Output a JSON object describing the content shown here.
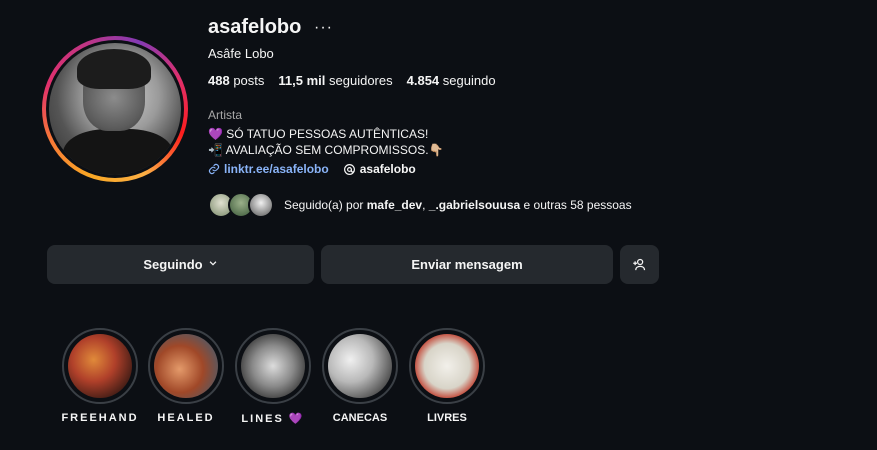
{
  "profile": {
    "username": "asafelobo",
    "more_icon": "more-horizontal-icon",
    "full_name": "Asâfe Lobo",
    "stats": {
      "posts_count": "488",
      "posts_label": "posts",
      "followers_count": "11,5 mil",
      "followers_label": "seguidores",
      "following_count": "4.854",
      "following_label": "seguindo"
    },
    "category": "Artista",
    "bio_line1": "💜 SÓ TATUO PESSOAS AUTÊNTICAS!",
    "bio_line2": "📲 AVALIAÇÃO SEM COMPROMISSOS.👇🏼",
    "link": "linktr.ee/asafelobo",
    "threads_handle": "asafelobo",
    "followed_by": {
      "prefix": "Seguido(a) por",
      "user1": "mafe_dev",
      "separator": ",",
      "user2": "_.gabrielsouusa",
      "suffix": "e outras 58 pessoas"
    }
  },
  "actions": {
    "following_label": "Seguindo",
    "message_label": "Enviar mensagem",
    "add_user_icon": "add-user-icon"
  },
  "highlights": [
    {
      "label": "FREEHAND"
    },
    {
      "label": "HEALED"
    },
    {
      "label": "LINES 💜"
    },
    {
      "label": "CANECAS"
    },
    {
      "label": "LIVRES"
    }
  ],
  "colors": {
    "background": "#0c0f14",
    "button_bg": "#25292e",
    "link": "#8ab4f8",
    "muted_text": "#a8a8a8"
  }
}
